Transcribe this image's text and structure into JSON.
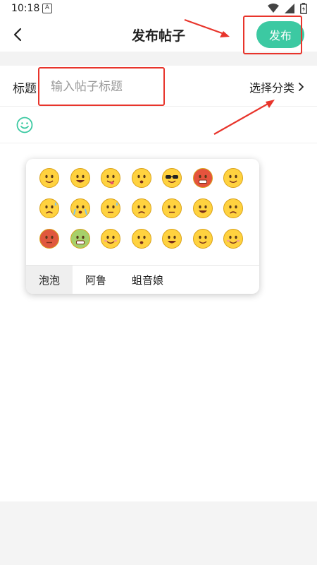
{
  "status_bar": {
    "time": "10:18",
    "notification_glyph": "A"
  },
  "header": {
    "title": "发布帖子",
    "publish_label": "发布"
  },
  "form": {
    "title_label": "标题",
    "title_placeholder": "输入帖子标题",
    "category_label": "选择分类"
  },
  "emoji_panel": {
    "tabs": [
      {
        "label": "泡泡",
        "active": true
      },
      {
        "label": "阿鲁",
        "active": false
      },
      {
        "label": "蛆音娘",
        "active": false
      }
    ],
    "emojis": [
      "smile-face-icon",
      "grin-face-icon",
      "tongue-face-icon",
      "angry-puff-face-icon",
      "sunglasses-face-icon",
      "red-angry-face-icon",
      "content-face-icon",
      "sweat-face-icon",
      "crying-face-icon",
      "cold-sweat-face-icon",
      "frown-face-icon",
      "annoyed-face-icon",
      "smirk-face-icon",
      "sad-face-icon",
      "red-face-icon",
      "sick-green-face-icon",
      "shy-face-icon",
      "squint-face-icon",
      "laugh-face-icon",
      "sly-face-icon",
      "giggle-face-icon"
    ]
  },
  "colors": {
    "accent": "#3cc9a2",
    "annotation": "#e8342b"
  }
}
